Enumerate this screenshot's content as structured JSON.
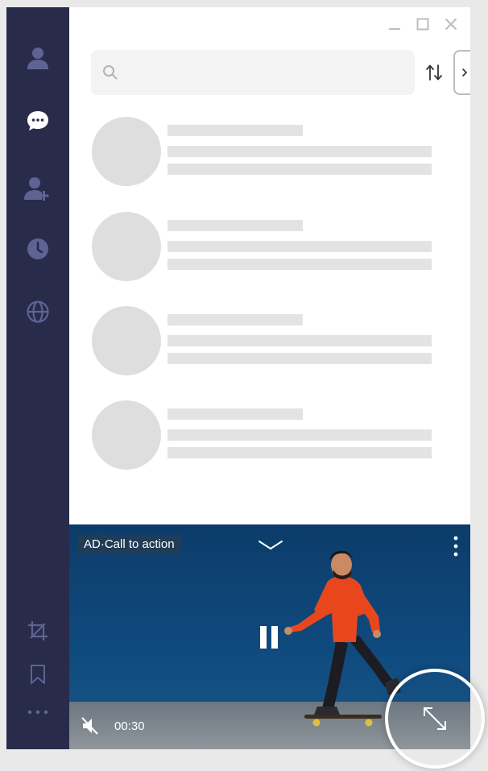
{
  "search": {
    "placeholder": ""
  },
  "sidebar": {
    "items": [
      {
        "icon": "person-icon"
      },
      {
        "icon": "chat-bubble-icon",
        "active": true
      },
      {
        "icon": "add-person-icon"
      },
      {
        "icon": "clock-icon"
      },
      {
        "icon": "globe-icon"
      }
    ],
    "bottom_items": [
      {
        "icon": "crop-icon"
      },
      {
        "icon": "bookmark-icon"
      },
      {
        "icon": "more-horizontal-icon"
      }
    ]
  },
  "window_controls": [
    "minimize-icon",
    "maximize-icon",
    "close-icon"
  ],
  "ad": {
    "label": "AD·Call to action",
    "time": "00:30"
  },
  "colors": {
    "sidebar_bg": "#282b4a",
    "sidebar_icon": "#5f6394",
    "sidebar_icon_active": "#ffffff",
    "skeleton": "#e3e3e3",
    "video_bg": "#0f4a7e"
  }
}
